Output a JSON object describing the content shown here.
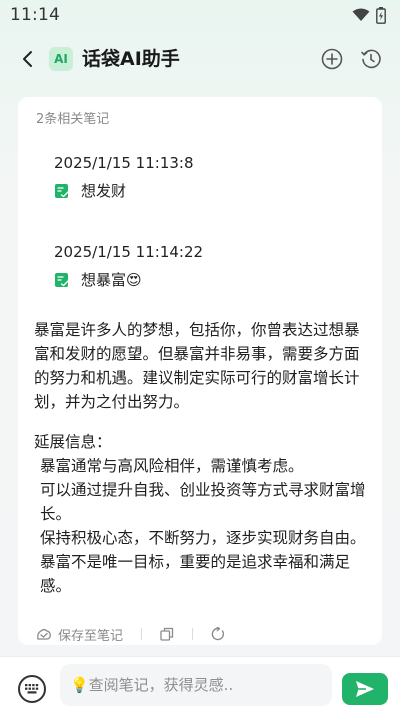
{
  "status": {
    "time": "11:14"
  },
  "header": {
    "badge": "AI",
    "title": "话袋AI助手"
  },
  "card": {
    "count_label": "2条相关笔记",
    "notes": [
      {
        "time": "2025/1/15 11:13:8",
        "text": "想发财"
      },
      {
        "time": "2025/1/15 11:14:22",
        "text": "想暴富😍"
      }
    ],
    "answer": "暴富是许多人的梦想，包括你，你曾表达过想暴富和发财的愿望。但暴富并非易事，需要多方面的努力和机遇。建议制定实际可行的财富增长计划，并为之付出努力。",
    "extend_title": "延展信息：",
    "extend_items": [
      "暴富通常与高风险相伴，需谨慎考虑。",
      "可以通过提升自我、创业投资等方式寻求财富增长。",
      "保持积极心态，不断努力，逐步实现财务自由。",
      "暴富不是唯一目标，重要的是追求幸福和满足感。"
    ],
    "save_label": "保存至笔记"
  },
  "bottom": {
    "placeholder": "💡查阅笔记，获得灵感.."
  },
  "colors": {
    "accent": "#21b36a",
    "badge_bg": "#c9efd7",
    "note_icon": "#21b36a"
  }
}
